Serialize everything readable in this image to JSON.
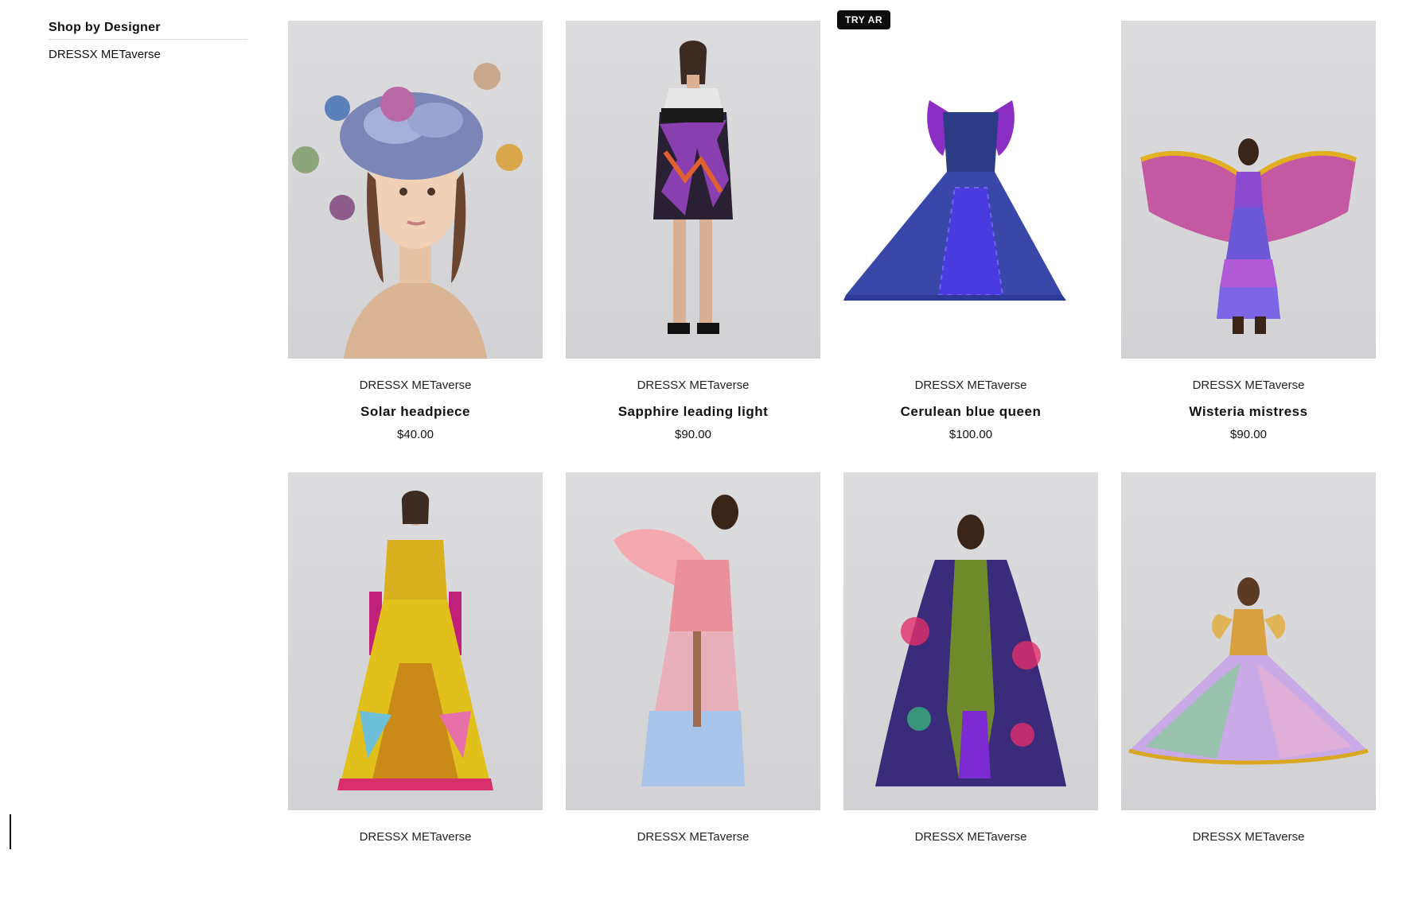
{
  "sidebar": {
    "title": "Shop by Designer",
    "designers": [
      "DRESSX METaverse"
    ]
  },
  "badge": {
    "label": "TRY AR"
  },
  "products": [
    {
      "designer": "DRESSX METaverse",
      "name": "Solar headpiece",
      "price": "$40.00"
    },
    {
      "designer": "DRESSX METaverse",
      "name": "Sapphire leading light",
      "price": "$90.00"
    },
    {
      "designer": "DRESSX METaverse",
      "name": "Cerulean blue queen",
      "price": "$100.00"
    },
    {
      "designer": "DRESSX METaverse",
      "name": "Wisteria mistress",
      "price": "$90.00"
    },
    {
      "designer": "DRESSX METaverse"
    },
    {
      "designer": "DRESSX METaverse"
    },
    {
      "designer": "DRESSX METaverse"
    },
    {
      "designer": "DRESSX METaverse"
    }
  ]
}
